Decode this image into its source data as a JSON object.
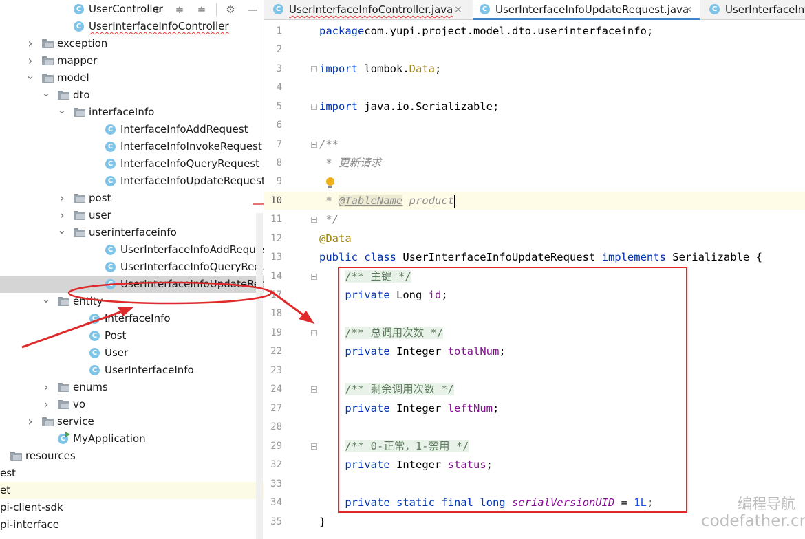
{
  "project_tree": {
    "rows": [
      {
        "label": "UserController",
        "depth": 4,
        "kind": "class",
        "expand": ""
      },
      {
        "label": "UserInterfaceInfoController",
        "depth": 4,
        "kind": "class",
        "expand": ""
      },
      {
        "label": "exception",
        "depth": 2,
        "kind": "folder",
        "expand": "collapsed"
      },
      {
        "label": "mapper",
        "depth": 2,
        "kind": "folder",
        "expand": "collapsed"
      },
      {
        "label": "model",
        "depth": 2,
        "kind": "folder",
        "expand": "expanded"
      },
      {
        "label": "dto",
        "depth": 3,
        "kind": "folder",
        "expand": "expanded"
      },
      {
        "label": "interfaceInfo",
        "depth": 4,
        "kind": "folder",
        "expand": "expanded"
      },
      {
        "label": "InterfaceInfoAddRequest",
        "depth": 6,
        "kind": "class",
        "expand": ""
      },
      {
        "label": "InterfaceInfoInvokeRequest",
        "depth": 6,
        "kind": "class",
        "expand": ""
      },
      {
        "label": "InterfaceInfoQueryRequest",
        "depth": 6,
        "kind": "class",
        "expand": ""
      },
      {
        "label": "InterfaceInfoUpdateRequest",
        "depth": 6,
        "kind": "class",
        "expand": ""
      },
      {
        "label": "post",
        "depth": 4,
        "kind": "folder",
        "expand": "collapsed"
      },
      {
        "label": "user",
        "depth": 4,
        "kind": "folder",
        "expand": "collapsed"
      },
      {
        "label": "userinterfaceinfo",
        "depth": 4,
        "kind": "folder",
        "expand": "expanded"
      },
      {
        "label": "UserInterfaceInfoAddRequest",
        "depth": 6,
        "kind": "class",
        "expand": ""
      },
      {
        "label": "UserInterfaceInfoQueryRequest",
        "depth": 6,
        "kind": "class",
        "expand": ""
      },
      {
        "label": "UserInterfaceInfoUpdateRequest",
        "depth": 6,
        "kind": "class",
        "expand": "",
        "selected": true
      },
      {
        "label": "entity",
        "depth": 3,
        "kind": "folder",
        "expand": "expanded"
      },
      {
        "label": "InterfaceInfo",
        "depth": 5,
        "kind": "class",
        "expand": ""
      },
      {
        "label": "Post",
        "depth": 5,
        "kind": "class",
        "expand": ""
      },
      {
        "label": "User",
        "depth": 5,
        "kind": "class",
        "expand": ""
      },
      {
        "label": "UserInterfaceInfo",
        "depth": 5,
        "kind": "class",
        "expand": ""
      },
      {
        "label": "enums",
        "depth": 3,
        "kind": "folder",
        "expand": "collapsed"
      },
      {
        "label": "vo",
        "depth": 3,
        "kind": "folder",
        "expand": "collapsed"
      },
      {
        "label": "service",
        "depth": 2,
        "kind": "folder",
        "expand": "collapsed"
      },
      {
        "label": "MyApplication",
        "depth": 3,
        "kind": "class-main",
        "expand": ""
      },
      {
        "label": "resources",
        "depth": 0,
        "kind": "folder",
        "expand": ""
      },
      {
        "label": "est",
        "depth": -1,
        "kind": "none",
        "expand": ""
      },
      {
        "label": "et",
        "depth": -1,
        "kind": "none",
        "expand": "",
        "highlighted": true
      },
      {
        "label": "pi-client-sdk",
        "depth": -1,
        "kind": "none",
        "expand": ""
      },
      {
        "label": "pi-interface",
        "depth": -1,
        "kind": "none",
        "expand": ""
      }
    ]
  },
  "toolbar_icons": [
    "locate-icon",
    "expand-all-icon",
    "collapse-all-icon",
    "settings-icon",
    "hide-icon"
  ],
  "editor_tabs": [
    {
      "label": "UserInterfaceInfoController.java",
      "active": false,
      "close": "×"
    },
    {
      "label": "UserInterfaceInfoUpdateRequest.java",
      "active": true,
      "close": "×"
    },
    {
      "label": "UserInterfaceInfo",
      "active": false,
      "close": ""
    }
  ],
  "code_lines": [
    {
      "num": "1",
      "tokens": [
        [
          "kw",
          "package"
        ],
        [
          "",
          "com.yupi.project.model.dto.userinterfaceinfo;"
        ]
      ]
    },
    {
      "num": "2",
      "tokens": []
    },
    {
      "num": "3",
      "tokens": [
        [
          "kw",
          "import"
        ],
        [
          "",
          " lombok."
        ],
        [
          "ann",
          "Data"
        ],
        [
          "",
          ";"
        ]
      ],
      "fold": true
    },
    {
      "num": "4",
      "tokens": []
    },
    {
      "num": "5",
      "tokens": [
        [
          "kw",
          "import"
        ],
        [
          "",
          " java.io.Serializable;"
        ]
      ],
      "fold": true
    },
    {
      "num": "6",
      "tokens": []
    },
    {
      "num": "7",
      "tokens": [
        [
          "cmt",
          "/**"
        ]
      ],
      "fold": true
    },
    {
      "num": "8",
      "tokens": [
        [
          "cmt",
          " * "
        ],
        [
          "cmt",
          "更新请求"
        ]
      ]
    },
    {
      "num": "9",
      "tokens": [],
      "bulb": true
    },
    {
      "num": "10",
      "tokens": [
        [
          "cmt",
          " * "
        ],
        [
          "doctag",
          "@TableName"
        ],
        [
          "cmt",
          " product"
        ]
      ],
      "current": true,
      "caret": true
    },
    {
      "num": "11",
      "tokens": [
        [
          "cmt",
          " */"
        ]
      ],
      "fold": true
    },
    {
      "num": "12",
      "tokens": [
        [
          "ann",
          "@Data"
        ]
      ]
    },
    {
      "num": "13",
      "tokens": [
        [
          "kw",
          "public class"
        ],
        [
          "",
          " UserInterfaceInfoUpdateRequest "
        ],
        [
          "kw",
          "implements"
        ],
        [
          "",
          " Serializable {"
        ]
      ]
    },
    {
      "num": "14",
      "tokens": [
        [
          "",
          "    "
        ],
        [
          "cmtbg",
          "/** 主键 */"
        ]
      ],
      "fold": true
    },
    {
      "num": "17",
      "tokens": [
        [
          "kw",
          "    private"
        ],
        [
          "",
          " Long "
        ],
        [
          "fld",
          "id"
        ],
        [
          "",
          ";"
        ]
      ]
    },
    {
      "num": "18",
      "tokens": []
    },
    {
      "num": "19",
      "tokens": [
        [
          "",
          "    "
        ],
        [
          "cmtbg",
          "/** 总调用次数 */"
        ]
      ],
      "fold": true
    },
    {
      "num": "22",
      "tokens": [
        [
          "kw",
          "    private"
        ],
        [
          "",
          " Integer "
        ],
        [
          "fld",
          "totalNum"
        ],
        [
          "",
          ";"
        ]
      ]
    },
    {
      "num": "23",
      "tokens": []
    },
    {
      "num": "24",
      "tokens": [
        [
          "",
          "    "
        ],
        [
          "cmtbg",
          "/** 剩余调用次数 */"
        ]
      ],
      "fold": true
    },
    {
      "num": "27",
      "tokens": [
        [
          "kw",
          "    private"
        ],
        [
          "",
          " Integer "
        ],
        [
          "fld",
          "leftNum"
        ],
        [
          "",
          ";"
        ]
      ]
    },
    {
      "num": "28",
      "tokens": []
    },
    {
      "num": "29",
      "tokens": [
        [
          "",
          "    "
        ],
        [
          "cmtbg",
          "/** 0-正常，1-禁用 */"
        ]
      ],
      "fold": true
    },
    {
      "num": "32",
      "tokens": [
        [
          "kw",
          "    private"
        ],
        [
          "",
          " Integer "
        ],
        [
          "fld",
          "status"
        ],
        [
          "",
          ";"
        ]
      ]
    },
    {
      "num": "33",
      "tokens": []
    },
    {
      "num": "34",
      "tokens": [
        [
          "kw",
          "    private static final long"
        ],
        [
          "",
          " "
        ],
        [
          "fldi",
          "serialVersionUID"
        ],
        [
          "",
          " = "
        ],
        [
          "num",
          "1L"
        ],
        [
          "",
          ";"
        ]
      ]
    },
    {
      "num": "35",
      "tokens": [
        [
          "",
          "}"
        ]
      ]
    }
  ],
  "watermark": {
    "line1": "编程导航",
    "line2": "codefather.cn"
  },
  "colors": {
    "annotation_red": "#de2a2a",
    "selection": "#d5d5d5",
    "keyword": "#0033b3",
    "field": "#871094"
  }
}
